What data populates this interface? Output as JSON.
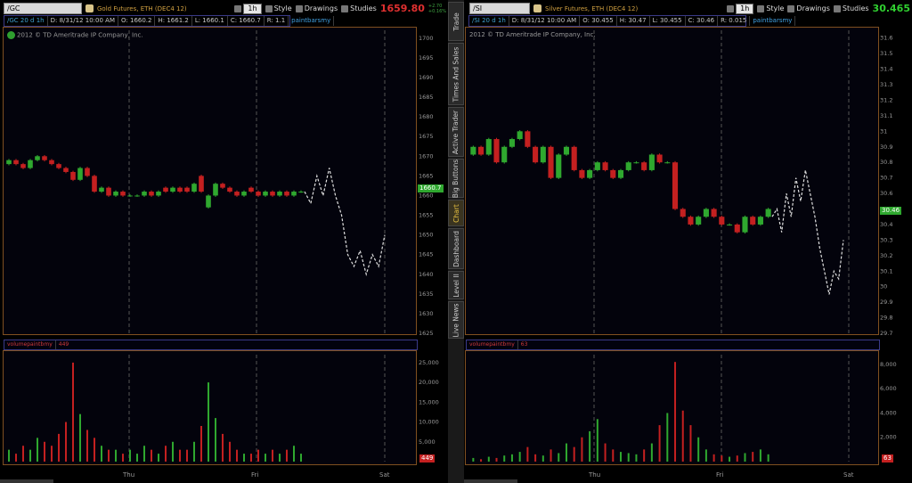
{
  "left": {
    "symbol": "/GC",
    "description": "Gold Futures, ETH (DEC4 12)",
    "period_button": "1h",
    "style_label": "Style",
    "drawings_label": "Drawings",
    "studies_label": "Studies",
    "last_price": "1659.80",
    "change_top": "+2.70",
    "change_bottom": "+0.16%",
    "info": [
      "/GC 20 d 1h",
      "D: 8/31/12 10:00 AM",
      "O: 1660.2",
      "H: 1661.2",
      "L: 1660.1",
      "C: 1660.7",
      "R: 1.1",
      "paintbarsmy"
    ],
    "copyright": "2012 © TD Ameritrade IP Company, Inc.",
    "volume_study": "volumepaintbmy",
    "volume_value": "449",
    "price_marker": "1660.7",
    "volume_marker": "449",
    "y_ticks": [
      "1700",
      "1695",
      "1690",
      "1685",
      "1680",
      "1675",
      "1670",
      "1665",
      "1660",
      "1655",
      "1650",
      "1645",
      "1640",
      "1635",
      "1630",
      "1625"
    ],
    "vol_ticks": [
      "25,000",
      "20,000",
      "15,000",
      "10,000",
      "5,000"
    ],
    "x_ticks": [
      "Thu",
      "Fri",
      "Sat"
    ]
  },
  "right": {
    "symbol": "/SI",
    "description": "Silver Futures, ETH (DEC4 12)",
    "period_button": "1h",
    "style_label": "Style",
    "drawings_label": "Drawings",
    "studies_label": "Studies",
    "last_price": "30.465",
    "info": [
      "/SI 20 d 1h",
      "D: 8/31/12 10:00 AM",
      "O: 30.455",
      "H: 30.47",
      "L: 30.455",
      "C: 30.46",
      "R: 0.015",
      "paintbarsmy"
    ],
    "copyright": "2012 © TD Ameritrade IP Company, Inc.",
    "volume_study": "volumepaintbmy",
    "volume_value": "63",
    "price_marker": "30.46",
    "volume_marker": "63",
    "y_ticks": [
      "31.6",
      "31.5",
      "31.4",
      "31.3",
      "31.2",
      "31.1",
      "31",
      "30.9",
      "30.8",
      "30.7",
      "30.6",
      "30.5",
      "30.4",
      "30.3",
      "30.2",
      "30.1",
      "30",
      "29.9",
      "29.8",
      "29.7"
    ],
    "vol_ticks": [
      "8,000",
      "6,000",
      "4,000",
      "2,000"
    ],
    "x_ticks": [
      "Thu",
      "Fri",
      "Sat"
    ]
  },
  "side_tabs": [
    "Trade",
    "Times And Sales",
    "Active Trader",
    "Big Buttons",
    "Chart",
    "Dashboard",
    "Level II",
    "Live News"
  ],
  "colors": {
    "up": "#2fa82f",
    "down": "#c42020",
    "projection": "#e0e0e0",
    "axis_border": "#805020",
    "gold_price": "#e03030",
    "silver_price": "#30d030"
  },
  "chart_data": [
    {
      "type": "candlestick",
      "title": "/GC 20 d 1h",
      "ylim": [
        1625,
        1702
      ],
      "closes": [
        1669,
        1668,
        1667,
        1669,
        1670,
        1669,
        1668,
        1667,
        1666,
        1664,
        1667,
        1665,
        1661,
        1662,
        1660,
        1661,
        1660,
        1660,
        1660,
        1661,
        1660,
        1661,
        1661,
        1662,
        1661,
        1661,
        1663,
        1661,
        1660,
        1663,
        1662,
        1661,
        1660,
        1661,
        1661,
        1660,
        1661,
        1660,
        1661,
        1660,
        1661,
        1661
      ],
      "opens": [
        1668,
        1669,
        1668,
        1667,
        1669,
        1670,
        1669,
        1668,
        1667,
        1666,
        1664,
        1667,
        1665,
        1661,
        1662,
        1660,
        1661,
        1660,
        1660,
        1660,
        1661,
        1660,
        1662,
        1661,
        1662,
        1662,
        1661,
        1665,
        1657,
        1660,
        1663,
        1662,
        1661,
        1660,
        1662,
        1661,
        1660,
        1661,
        1660,
        1661,
        1660,
        1661
      ],
      "projection": [
        1661,
        1658,
        1665,
        1660,
        1667,
        1660,
        1655,
        1645,
        1642,
        1646,
        1640,
        1645,
        1642,
        1650
      ],
      "volume": [
        3,
        2,
        4,
        3,
        6,
        5,
        4,
        7,
        10,
        25,
        12,
        8,
        6,
        4,
        3,
        3,
        2,
        3,
        2,
        4,
        3,
        2,
        4,
        5,
        3,
        3,
        5,
        9,
        20,
        11,
        7,
        5,
        3,
        2,
        2,
        3,
        2,
        3,
        2,
        3,
        4,
        2
      ]
    },
    {
      "type": "candlestick",
      "title": "/SI 20 d 1h",
      "ylim": [
        29.7,
        31.65
      ],
      "closes": [
        30.9,
        30.85,
        30.95,
        30.8,
        30.9,
        30.95,
        31.0,
        30.9,
        30.8,
        30.9,
        30.7,
        30.85,
        30.9,
        30.75,
        30.7,
        30.75,
        30.8,
        30.75,
        30.7,
        30.75,
        30.8,
        30.8,
        30.75,
        30.85,
        30.8,
        30.8,
        30.5,
        30.45,
        30.4,
        30.45,
        30.5,
        30.45,
        30.4,
        30.4,
        30.35,
        30.45,
        30.4,
        30.45,
        30.5
      ],
      "opens": [
        30.85,
        30.9,
        30.85,
        30.95,
        30.8,
        30.9,
        30.95,
        31.0,
        30.9,
        30.8,
        30.9,
        30.7,
        30.85,
        30.9,
        30.75,
        30.7,
        30.75,
        30.8,
        30.75,
        30.7,
        30.75,
        30.8,
        30.8,
        30.75,
        30.85,
        30.8,
        30.8,
        30.5,
        30.45,
        30.4,
        30.45,
        30.5,
        30.45,
        30.4,
        30.4,
        30.35,
        30.45,
        30.4,
        30.45
      ],
      "projection": [
        30.45,
        30.5,
        30.35,
        30.6,
        30.45,
        30.7,
        30.55,
        30.75,
        30.6,
        30.45,
        30.25,
        30.1,
        29.95,
        30.1,
        30.05,
        30.3
      ],
      "volume": [
        0.3,
        0.2,
        0.4,
        0.3,
        0.5,
        0.6,
        0.8,
        1.2,
        0.6,
        0.5,
        1.0,
        0.7,
        1.5,
        1.2,
        2.0,
        2.5,
        3.5,
        1.5,
        1.0,
        0.8,
        0.7,
        0.6,
        1.0,
        1.5,
        3.0,
        4.0,
        8.2,
        4.2,
        3.0,
        2.0,
        1.0,
        0.6,
        0.5,
        0.4,
        0.5,
        0.7,
        0.8,
        1.0,
        0.6
      ]
    }
  ]
}
